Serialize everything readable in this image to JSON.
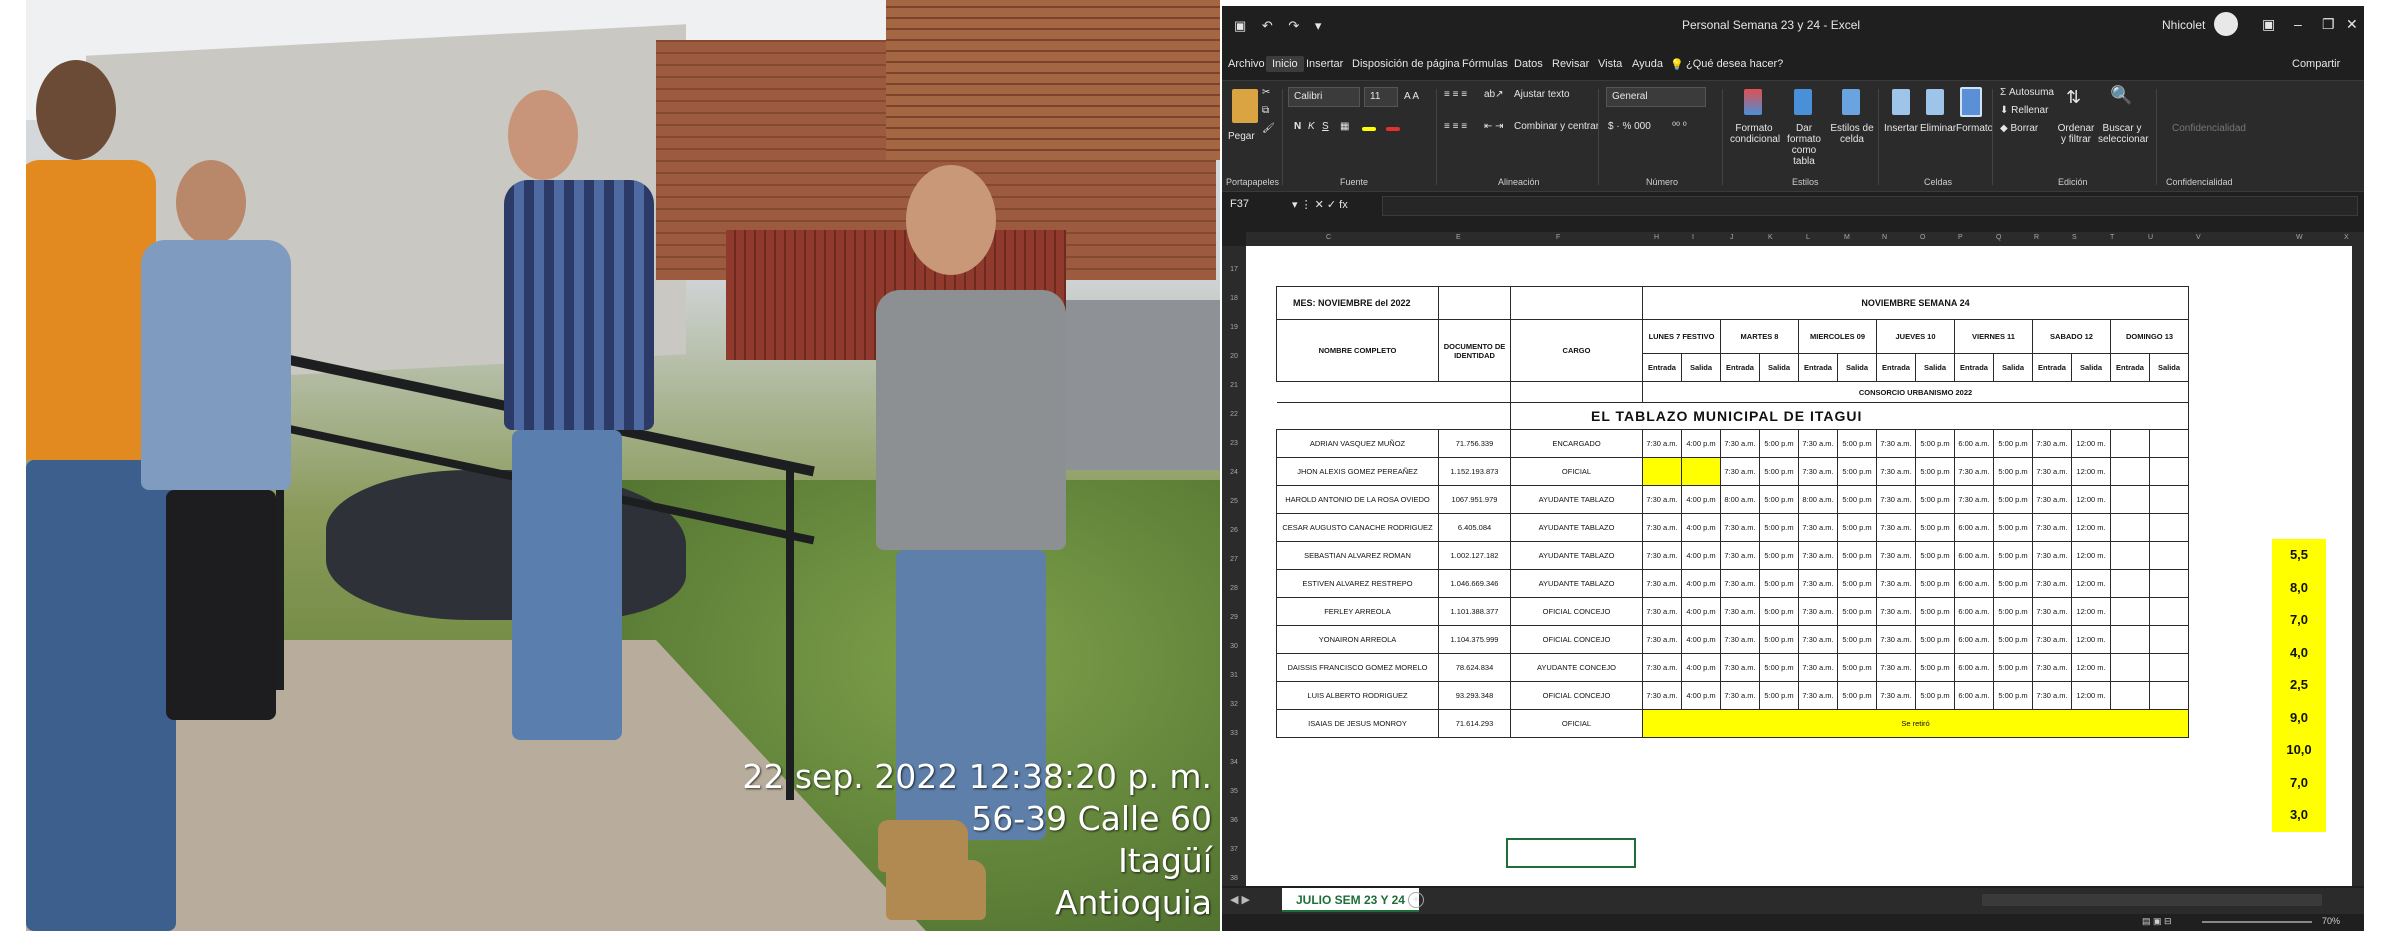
{
  "photo": {
    "timestamp": "22 sep. 2022 12:38:20 p. m.",
    "address": "56-39 Calle 60",
    "city": "Itagüí",
    "region": "Antioquia"
  },
  "excel": {
    "window_title": "Personal  Semana 23 y 24  -  Excel",
    "user_name": "Nhicolet",
    "share_label": "Compartir",
    "menu": [
      "Archivo",
      "Inicio",
      "Insertar",
      "Disposición de página",
      "Fórmulas",
      "Datos",
      "Revisar",
      "Vista",
      "Ayuda",
      "¿Qué desea hacer?"
    ],
    "ribbon": {
      "paste": "Pegar",
      "font_name": "Calibri",
      "font_size": "11",
      "wrap_text": "Ajustar texto",
      "merge": "Combinar y centrar",
      "number_format": "General",
      "cond_format": "Formato condicional",
      "format_table": "Dar formato como tabla",
      "cell_styles": "Estilos de celda",
      "insert": "Insertar",
      "delete": "Eliminar",
      "format": "Formato",
      "autosum": "Autosuma",
      "fill": "Rellenar",
      "clear": "Borrar",
      "sort_filter": "Ordenar y filtrar",
      "find_select": "Buscar y seleccionar",
      "sensitivity": "Confidencialidad",
      "groups": [
        "Portapapeles",
        "Fuente",
        "Alineación",
        "Número",
        "Estilos",
        "Celdas",
        "Edición",
        "Confidencialidad"
      ]
    },
    "name_box": "F37",
    "columns": [
      "C",
      "E",
      "F",
      "H",
      "I",
      "J",
      "K",
      "L",
      "M",
      "N",
      "O",
      "P",
      "Q",
      "R",
      "S",
      "T",
      "U",
      "V",
      "W",
      "X"
    ],
    "row_numbers": [
      "17",
      "18",
      "19",
      "20",
      "21",
      "22",
      "23",
      "24",
      "25",
      "26",
      "27",
      "28",
      "29",
      "30",
      "31",
      "32",
      "33",
      "34",
      "35",
      "36",
      "37",
      "38"
    ],
    "sheet": {
      "mes_label": "MES:  NOVIEMBRE del 2022",
      "week_label": "NOVIEMBRE  SEMANA 24",
      "col_name": "NOMBRE COMPLETO",
      "col_doc": "DOCUMENTO DE IDENTIDAD",
      "col_cargo": "CARGO",
      "days": [
        "LUNES 7 FESTIVO",
        "MARTES 8",
        "MIERCOLES 09",
        "JUEVES 10",
        "VIERNES 11",
        "SABADO 12",
        "DOMINGO 13"
      ],
      "entrada": "Entrada",
      "salida": "Salida",
      "consorcio": "CONSORCIO URBANISMO 2022",
      "project": "EL  TABLAZO  MUNICIPAL  DE  ITAGUI",
      "rows": [
        {
          "name": "ADRIAN VASQUEZ MUÑOZ",
          "doc": "71.756.339",
          "cargo": "ENCARGADO",
          "times": [
            "7:30 a.m.",
            "4:00 p.m",
            "7:30 a.m.",
            "5:00 p.m",
            "7:30 a.m.",
            "5:00 p.m",
            "7:30 a.m.",
            "5:00 p.m",
            "6:00 a.m.",
            "5:00 p.m",
            "7:30 a.m.",
            "12:00 m.",
            "",
            ""
          ]
        },
        {
          "name": "JHON ALEXIS GOMEZ PEREAÑEZ",
          "doc": "1.152.193.873",
          "cargo": "OFICIAL",
          "times": [
            "",
            "",
            "7:30 a.m.",
            "5:00 p.m",
            "7:30 a.m.",
            "5:00 p.m",
            "7:30 a.m.",
            "5:00 p.m",
            "7:30 a.m.",
            "5:00 p.m",
            "7:30 a.m.",
            "12:00 m.",
            "",
            ""
          ]
        },
        {
          "name": "HAROLD ANTONIO DE LA ROSA OVIEDO",
          "doc": "1067.951.979",
          "cargo": "AYUDANTE  TABLAZO",
          "times": [
            "7:30 a.m.",
            "4:00 p.m",
            "8:00 a.m.",
            "5:00 p.m",
            "8:00 a.m.",
            "5:00 p.m",
            "7:30 a.m.",
            "5:00 p.m",
            "7:30 a.m.",
            "5:00 p.m",
            "7:30 a.m.",
            "12:00 m.",
            "",
            ""
          ]
        },
        {
          "name": "CESAR AUGUSTO CANACHE RODRIGUEZ",
          "doc": "6.405.084",
          "cargo": "AYUDANTE  TABLAZO",
          "times": [
            "7:30 a.m.",
            "4:00 p.m",
            "7:30 a.m.",
            "5:00 p.m",
            "7:30 a.m.",
            "5:00 p.m",
            "7:30 a.m.",
            "5:00 p.m",
            "6:00 a.m.",
            "5:00 p.m",
            "7:30 a.m.",
            "12:00 m.",
            "",
            ""
          ]
        },
        {
          "name": "SEBASTIAN ALVAREZ ROMAN",
          "doc": "1.002.127.182",
          "cargo": "AYUDANTE  TABLAZO",
          "times": [
            "7:30 a.m.",
            "4:00 p.m",
            "7:30 a.m.",
            "5:00 p.m",
            "7:30 a.m.",
            "5:00 p.m",
            "7:30 a.m.",
            "5:00 p.m",
            "6:00 a.m.",
            "5:00 p.m",
            "7:30 a.m.",
            "12:00 m.",
            "",
            ""
          ]
        },
        {
          "name": "ESTIVEN ALVAREZ RESTREPO",
          "doc": "1.046.669.346",
          "cargo": "AYUDANTE  TABLAZO",
          "times": [
            "7:30 a.m.",
            "4:00 p.m",
            "7:30 a.m.",
            "5:00 p.m",
            "7:30 a.m.",
            "5:00 p.m",
            "7:30 a.m.",
            "5:00 p.m",
            "6:00 a.m.",
            "5:00 p.m",
            "7:30 a.m.",
            "12:00 m.",
            "",
            ""
          ]
        },
        {
          "name": "FERLEY  ARREOLA",
          "doc": "1.101.388.377",
          "cargo": "OFICIAL CONCEJO",
          "times": [
            "7:30 a.m.",
            "4:00 p.m",
            "7:30 a.m.",
            "5:00 p.m",
            "7:30 a.m.",
            "5:00 p.m",
            "7:30 a.m.",
            "5:00 p.m",
            "6:00 a.m.",
            "5:00 p.m",
            "7:30 a.m.",
            "12:00 m.",
            "",
            ""
          ]
        },
        {
          "name": "YONAIRON ARREOLA",
          "doc": "1.104.375.999",
          "cargo": "OFICIAL CONCEJO",
          "times": [
            "7:30 a.m.",
            "4:00 p.m",
            "7:30 a.m.",
            "5:00 p.m",
            "7:30 a.m.",
            "5:00 p.m",
            "7:30 a.m.",
            "5:00 p.m",
            "6:00 a.m.",
            "5:00 p.m",
            "7:30 a.m.",
            "12:00 m.",
            "",
            ""
          ]
        },
        {
          "name": "DAISSIS FRANCISCO GOMEZ MORELO",
          "doc": "78.624.834",
          "cargo": "AYUDANTE CONCEJO",
          "times": [
            "7:30 a.m.",
            "4:00 p.m",
            "7:30 a.m.",
            "5:00 p.m",
            "7:30 a.m.",
            "5:00 p.m",
            "7:30 a.m.",
            "5:00 p.m",
            "6:00 a.m.",
            "5:00 p.m",
            "7:30 a.m.",
            "12:00 m.",
            "",
            ""
          ]
        },
        {
          "name": "LUIS ALBERTO RODRIGUEZ",
          "doc": "93.293.348",
          "cargo": "OFICIAL CONCEJO",
          "times": [
            "7:30 a.m.",
            "4:00 p.m",
            "7:30 a.m.",
            "5:00 p.m",
            "7:30 a.m.",
            "5:00 p.m",
            "7:30 a.m.",
            "5:00 p.m",
            "6:00 a.m.",
            "5:00 p.m",
            "7:30 a.m.",
            "12:00 m.",
            "",
            ""
          ]
        }
      ],
      "last_row": {
        "name": "ISAIAS DE JESUS MONROY",
        "doc": "71.614.293",
        "cargo": "OFICIAL",
        "note": "Se retiró"
      },
      "hours": [
        "5,5",
        "8,0",
        "7,0",
        "4,0",
        "2,5",
        "9,0",
        "10,0",
        "7,0",
        "3,0"
      ]
    },
    "sheet_tab": "JULIO SEM 23 Y 24",
    "zoom": "70%",
    "colors": {
      "accent_green": "#1e6e3a",
      "highlight_yellow": "#ffff00"
    }
  }
}
